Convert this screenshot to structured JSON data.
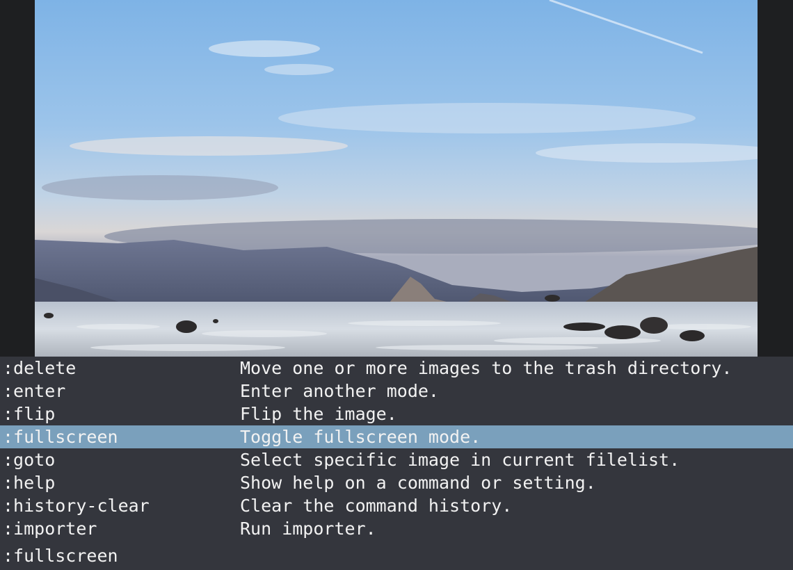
{
  "completion": {
    "rows": [
      {
        "command": ":delete",
        "description": "Move one or more images to the trash directory."
      },
      {
        "command": ":enter",
        "description": "Enter another mode."
      },
      {
        "command": ":flip",
        "description": "Flip the image."
      },
      {
        "command": ":fullscreen",
        "description": "Toggle fullscreen mode."
      },
      {
        "command": ":goto",
        "description": "Select specific image in current filelist."
      },
      {
        "command": ":help",
        "description": "Show help on a command or setting."
      },
      {
        "command": ":history-clear",
        "description": "Clear the command history."
      },
      {
        "command": ":importer",
        "description": "Run importer."
      }
    ],
    "selected_index": 3
  },
  "command_line": {
    "text": ":fullscreen"
  },
  "colors": {
    "completion_bg": "#34363d",
    "selection_bg": "#7aa0bc",
    "text": "#f2f2f2",
    "viewport_bg": "#1e1f21"
  }
}
